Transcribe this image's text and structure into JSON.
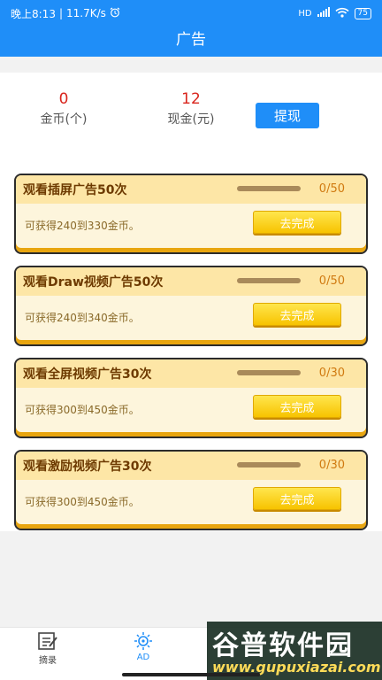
{
  "status_bar": {
    "time": "晚上8:13",
    "speed": "11.7K/s",
    "signal": "HD",
    "battery": "75"
  },
  "header": {
    "title": "广告"
  },
  "summary": {
    "coins_value": "0",
    "coins_label": "金币(个)",
    "cash_value": "12",
    "cash_label": "现金(元)",
    "withdraw_label": "提现"
  },
  "tasks": [
    {
      "title": "观看插屏广告50次",
      "progress_text": "0/50",
      "progress": 0,
      "reward": "可获得240到330金币。",
      "button": "去完成"
    },
    {
      "title": "观看Draw视频广告50次",
      "progress_text": "0/50",
      "progress": 0,
      "reward": "可获得240到340金币。",
      "button": "去完成"
    },
    {
      "title": "观看全屏视频广告30次",
      "progress_text": "0/30",
      "progress": 0,
      "reward": "可获得300到450金币。",
      "button": "去完成"
    },
    {
      "title": "观看激励视频广告30次",
      "progress_text": "0/30",
      "progress": 0,
      "reward": "可获得300到450金币。",
      "button": "去完成"
    }
  ],
  "tabbar": {
    "tab1_label": "摘录",
    "tab2_label": "AD",
    "active_color": "#1f8ef8"
  },
  "watermark": {
    "line1": "谷普软件园",
    "line2": "www.gupuxiazai.com"
  },
  "colors": {
    "header_bg": "#1f8ef8",
    "value_red": "#d9251d",
    "card_border": "#2b2b2b",
    "button_yellow": "#f7c300"
  }
}
